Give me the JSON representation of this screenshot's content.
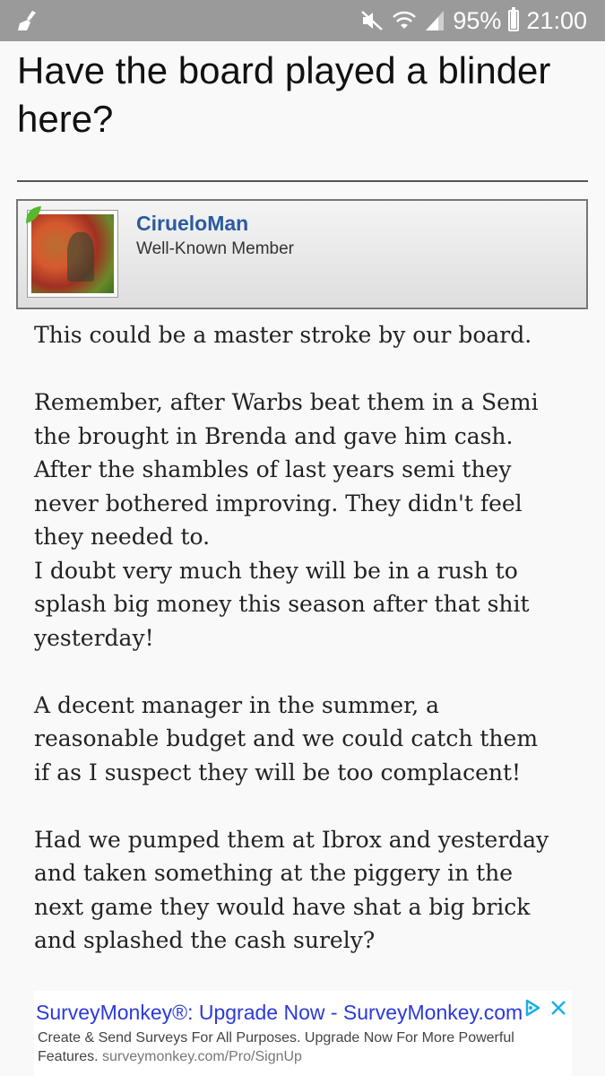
{
  "status_bar": {
    "battery": "95%",
    "time": "21:00",
    "icons": [
      "broom-icon",
      "mute-icon",
      "wifi-icon",
      "signal-icon",
      "battery-icon"
    ]
  },
  "thread": {
    "title_lines": [
      "Have the board played a blinder",
      "here?"
    ]
  },
  "post": {
    "author": "CirueloMan",
    "author_title": "Well-Known Member",
    "paragraphs": [
      [
        "This could be a master stroke by our board."
      ],
      [
        "Remember, after Warbs beat them in a Semi",
        "the brought in Brenda and gave him cash.",
        "After the shambles of last years semi they",
        "never bothered improving. They didn't feel",
        "they needed to.",
        "I doubt very much they will be in a rush to",
        "splash big money this season after that shit",
        "yesterday!"
      ],
      [
        "A decent manager in the summer, a",
        "reasonable budget and we could catch them",
        "if as I suspect they will be too complacent!"
      ],
      [
        "Had we pumped them at Ibrox and yesterday",
        "and taken something at the piggery in the",
        "next game they would have shat a big brick",
        "and splashed the cash surely?"
      ]
    ]
  },
  "ad": {
    "headline": "SurveyMonkey®: Upgrade Now - SurveyMonkey.com",
    "description_line1": "Create & Send Surveys For All Purposes. Upgrade Now For More Powerful",
    "description_line2": "Features.",
    "url": "surveymonkey.com/Pro/SignUp"
  },
  "colors": {
    "status_bar": "#9a9a9a",
    "username": "#2a5aa0",
    "ad_headline": "#2b3ad8",
    "adchoices": "#1ab0e8"
  }
}
